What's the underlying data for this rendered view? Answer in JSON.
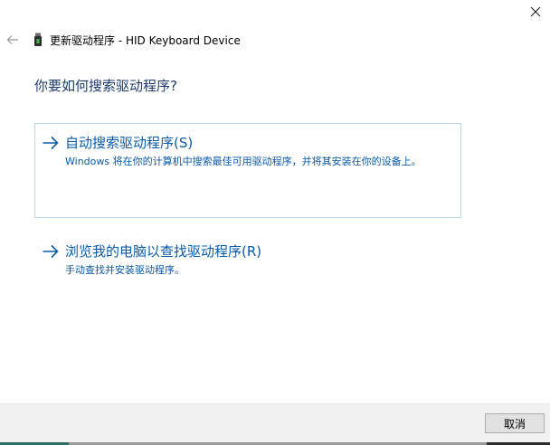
{
  "window": {
    "title": "更新驱动程序 - HID Keyboard Device",
    "close_label": "×"
  },
  "heading": "你要如何搜索驱动程序?",
  "options": [
    {
      "title": "自动搜索驱动程序(S)",
      "description": "Windows 将在你的计算机中搜索最佳可用驱动程序，并将其安装在你的设备上。"
    },
    {
      "title": "浏览我的电脑以查找驱动程序(R)",
      "description": "手动查找并安装驱动程序。"
    }
  ],
  "footer": {
    "cancel_label": "取消"
  },
  "colors": {
    "link_blue": "#0a5aa8",
    "heading_blue": "#1c3a6b",
    "option_border": "#b9d5e6",
    "footer_bg": "#f0f0f0"
  },
  "icons": {
    "back": "arrow-left-icon",
    "device": "usb-device-icon",
    "option_arrow": "arrow-right-icon",
    "close": "close-icon"
  }
}
